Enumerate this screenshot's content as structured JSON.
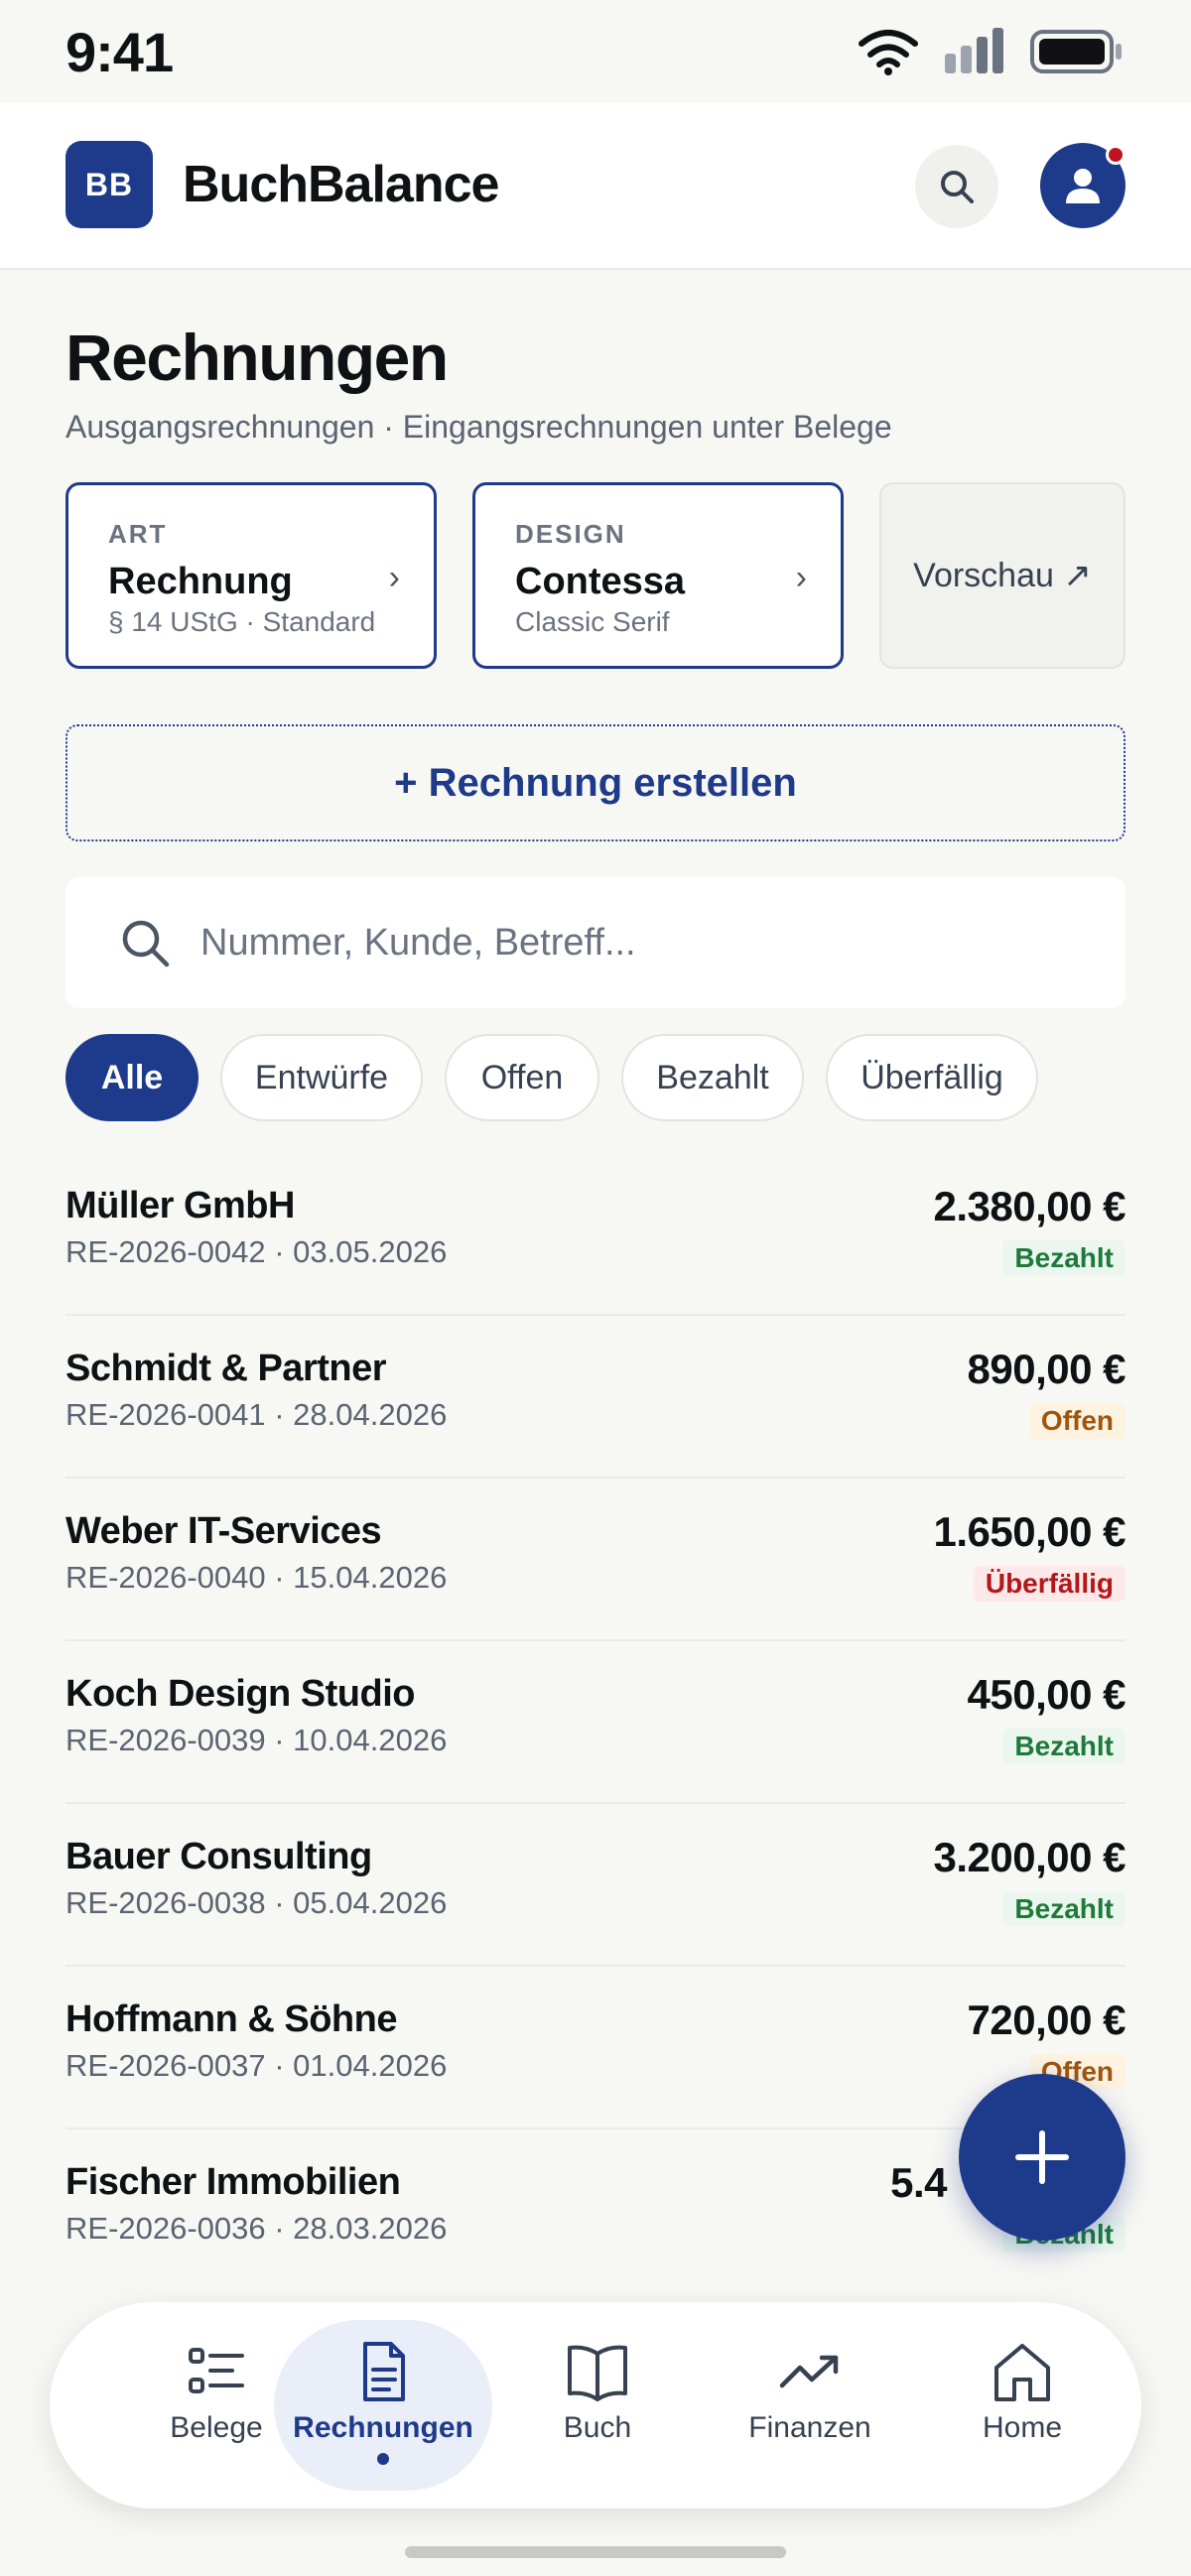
{
  "status_bar": {
    "time": "9:41"
  },
  "app": {
    "logo": "BB",
    "name": "BuchBalance"
  },
  "page": {
    "title": "Rechnungen",
    "subtitle": "Ausgangsrechnungen · Eingangsrechnungen unter Belege"
  },
  "cards": {
    "art": {
      "eyebrow": "ART",
      "title": "Rechnung",
      "sub": "§ 14 UStG · Standard"
    },
    "design": {
      "eyebrow": "DESIGN",
      "title": "Contessa",
      "sub": "Classic Serif"
    },
    "preview": "Vorschau ↗"
  },
  "create_button": "+ Rechnung erstellen",
  "search": {
    "placeholder": "Nummer, Kunde, Betreff..."
  },
  "filters": [
    {
      "label": "Alle",
      "active": true
    },
    {
      "label": "Entwürfe",
      "active": false
    },
    {
      "label": "Offen",
      "active": false
    },
    {
      "label": "Bezahlt",
      "active": false
    },
    {
      "label": "Überfällig",
      "active": false
    }
  ],
  "invoices": [
    {
      "name": "Müller GmbH",
      "meta": "RE-2026-0042 · 03.05.2026",
      "amount": "2.380,00 €",
      "status": "Bezahlt"
    },
    {
      "name": "Schmidt & Partner",
      "meta": "RE-2026-0041 · 28.04.2026",
      "amount": "890,00 €",
      "status": "Offen"
    },
    {
      "name": "Weber IT-Services",
      "meta": "RE-2026-0040 · 15.04.2026",
      "amount": "1.650,00 €",
      "status": "Überfällig"
    },
    {
      "name": "Koch Design Studio",
      "meta": "RE-2026-0039 · 10.04.2026",
      "amount": "450,00 €",
      "status": "Bezahlt"
    },
    {
      "name": "Bauer Consulting",
      "meta": "RE-2026-0038 · 05.04.2026",
      "amount": "3.200,00 €",
      "status": "Bezahlt"
    },
    {
      "name": "Hoffmann & Söhne",
      "meta": "RE-2026-0037 · 01.04.2026",
      "amount": "720,00 €",
      "status": "Offen"
    },
    {
      "name": "Fischer Immobilien",
      "meta": "RE-2026-0036 · 28.03.2026",
      "amount": "5.4",
      "status": "Bezahlt"
    }
  ],
  "tabs": [
    {
      "label": "Belege",
      "icon": "list-icon",
      "active": false
    },
    {
      "label": "Rechnungen",
      "icon": "document-icon",
      "active": true
    },
    {
      "label": "Buch",
      "icon": "book-icon",
      "active": false
    },
    {
      "label": "Finanzen",
      "icon": "trending-up-icon",
      "active": false
    },
    {
      "label": "Home",
      "icon": "home-icon",
      "active": false
    }
  ],
  "colors": {
    "accent": "#1e3a8a",
    "background": "#f7f7f4",
    "paid": "#1e7a3a",
    "open": "#a0550f",
    "overdue": "#b3161b"
  }
}
